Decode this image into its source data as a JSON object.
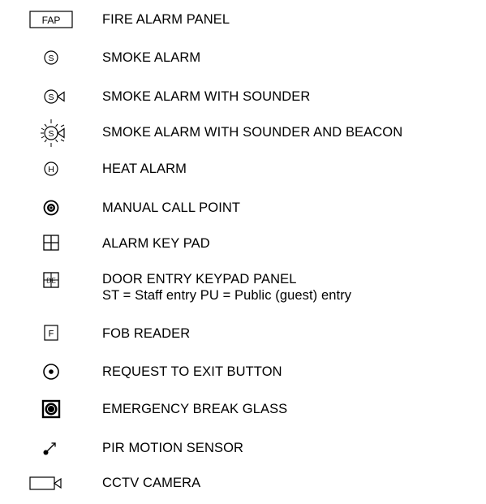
{
  "legend": {
    "items": [
      {
        "icon": "fire-alarm-panel-icon",
        "text": "FAP",
        "label": "FIRE ALARM PANEL"
      },
      {
        "icon": "smoke-alarm-icon",
        "text": "S",
        "label": "SMOKE ALARM"
      },
      {
        "icon": "smoke-alarm-sounder-icon",
        "text": "S",
        "label": "SMOKE ALARM WITH SOUNDER"
      },
      {
        "icon": "smoke-alarm-sounder-beacon-icon",
        "text": "S",
        "label": "SMOKE ALARM WITH SOUNDER AND BEACON"
      },
      {
        "icon": "heat-alarm-icon",
        "text": "H",
        "label": "HEAT ALARM"
      },
      {
        "icon": "manual-call-point-icon",
        "label": "MANUAL CALL POINT"
      },
      {
        "icon": "alarm-key-pad-icon",
        "label": "ALARM KEY PAD"
      },
      {
        "icon": "door-entry-keypad-icon",
        "text": "DE",
        "label": "DOOR ENTRY KEYPAD PANEL",
        "sublabel": "ST = Staff entry PU = Public (guest) entry"
      },
      {
        "icon": "fob-reader-icon",
        "text": "F",
        "label": "FOB READER"
      },
      {
        "icon": "request-to-exit-icon",
        "label": "REQUEST TO EXIT BUTTON"
      },
      {
        "icon": "emergency-break-glass-icon",
        "label": "EMERGENCY BREAK GLASS"
      },
      {
        "icon": "pir-motion-sensor-icon",
        "label": "PIR MOTION SENSOR"
      },
      {
        "icon": "cctv-camera-icon",
        "label": "CCTV CAMERA"
      }
    ]
  }
}
